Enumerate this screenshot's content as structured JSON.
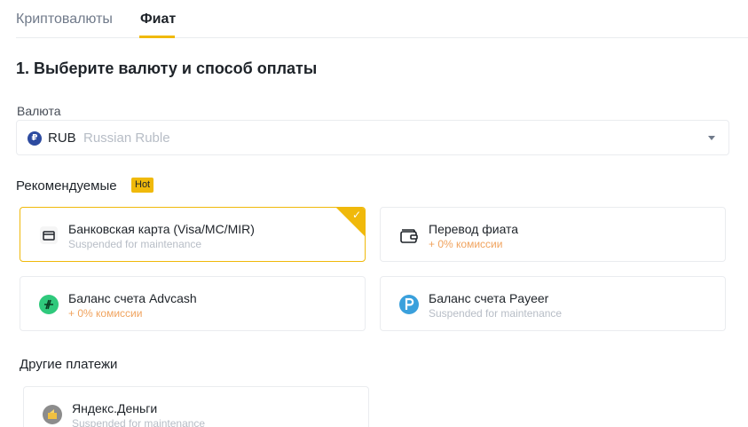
{
  "tabs": [
    {
      "label": "Криптовалюты"
    },
    {
      "label": "Фиат"
    }
  ],
  "section": {
    "title": "1. Выберите валюту и способ оплаты"
  },
  "currency": {
    "label": "Валюта",
    "code": "RUB",
    "name": "Russian Ruble",
    "icon_symbol": "₽",
    "icon": "ruble-coin-icon"
  },
  "recommended": {
    "label": "Рекомендуемые",
    "badge": "Hot",
    "methods": [
      {
        "title": "Банковская карта (Visa/MC/MIR)",
        "subtitle": "Suspended for maintenance",
        "icon": "card-icon",
        "selected": true
      },
      {
        "title": "Перевод фиата",
        "subtitle": "+ 0% комиссии",
        "icon": "wallet-icon",
        "selected": false
      },
      {
        "title": "Баланс счета Advcash",
        "subtitle": "+ 0% комиссии",
        "icon": "advcash-icon",
        "selected": false
      },
      {
        "title": "Баланс счета Payeer",
        "subtitle": "Suspended for maintenance",
        "icon": "payeer-icon",
        "selected": false
      }
    ]
  },
  "other": {
    "label": "Другие платежи",
    "methods": [
      {
        "title": "Яндекс.Деньги",
        "subtitle": "Suspended for maintenance",
        "icon": "yandex-money-icon"
      }
    ]
  },
  "colors": {
    "accent": "#f0b90b",
    "fee_text": "#f0a35e",
    "muted_text": "#b7bdc6",
    "border": "#eaecef"
  }
}
